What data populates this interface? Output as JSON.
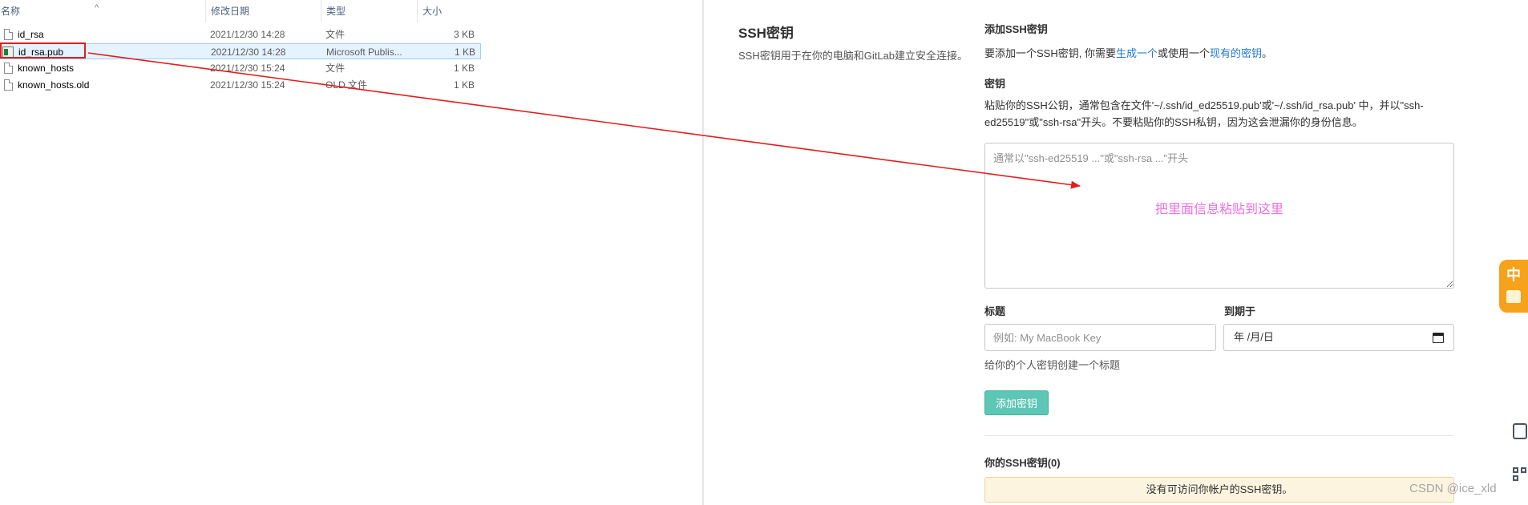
{
  "explorer": {
    "columns": {
      "name": "名称",
      "modified": "修改日期",
      "type": "类型",
      "size": "大小"
    },
    "files": [
      {
        "name": "id_rsa",
        "modified": "2021/12/30 14:28",
        "type": "文件",
        "size": "3 KB"
      },
      {
        "name": "id_rsa.pub",
        "modified": "2021/12/30 14:28",
        "type": "Microsoft Publis...",
        "size": "1 KB"
      },
      {
        "name": "known_hosts",
        "modified": "2021/12/30 15:24",
        "type": "文件",
        "size": "1 KB"
      },
      {
        "name": "known_hosts.old",
        "modified": "2021/12/30 15:24",
        "type": "OLD 文件",
        "size": "1 KB"
      }
    ]
  },
  "gitlab": {
    "section_title": "SSH密钥",
    "section_desc": "SSH密钥用于在你的电脑和GitLab建立安全连接。",
    "add_heading": "添加SSH密钥",
    "add_prefix": "要添加一个SSH密钥, 你需要",
    "add_link_generate": "生成一个",
    "add_middle": "或使用一个",
    "add_link_existing": "现有的密钥",
    "add_suffix": "。",
    "key_label": "密钥",
    "key_help": "粘贴你的SSH公钥，通常包含在文件'~/.ssh/id_ed25519.pub'或'~/.ssh/id_rsa.pub' 中，并以\"ssh-ed25519\"或\"ssh-rsa\"开头。不要粘贴你的SSH私钥，因为这会泄漏你的身份信息。",
    "key_placeholder": "通常以\"ssh-ed25519 ...\"或\"ssh-rsa ...\"开头",
    "paste_annotation": "把里面信息粘贴到这里",
    "title_label": "标题",
    "title_placeholder": "例如: My MacBook Key",
    "expires_label": "到期于",
    "expires_value": "年 /月/日",
    "title_help": "给你的个人密钥创建一个标题",
    "add_button": "添加密钥",
    "your_keys_heading": "你的SSH密钥(0)",
    "no_keys_message": "没有可访问你帐户的SSH密钥。"
  },
  "watermark": "CSDN @ice_xld",
  "ime": {
    "char": "中"
  },
  "icons": {
    "file": "file-icon",
    "publisher": "publisher-file-icon",
    "calendar": "calendar-icon",
    "sort": "sort-up-icon",
    "edit": "edit-icon",
    "qr": "qr-code-icon"
  },
  "colors": {
    "annotation_red": "#e11d1d",
    "paste_hint_pink": "#ee6fe0",
    "link_blue": "#1f78d1",
    "button_teal": "#5ec6b5",
    "alert_bg": "#fdf4e0",
    "ime_orange": "#f6a21a"
  }
}
